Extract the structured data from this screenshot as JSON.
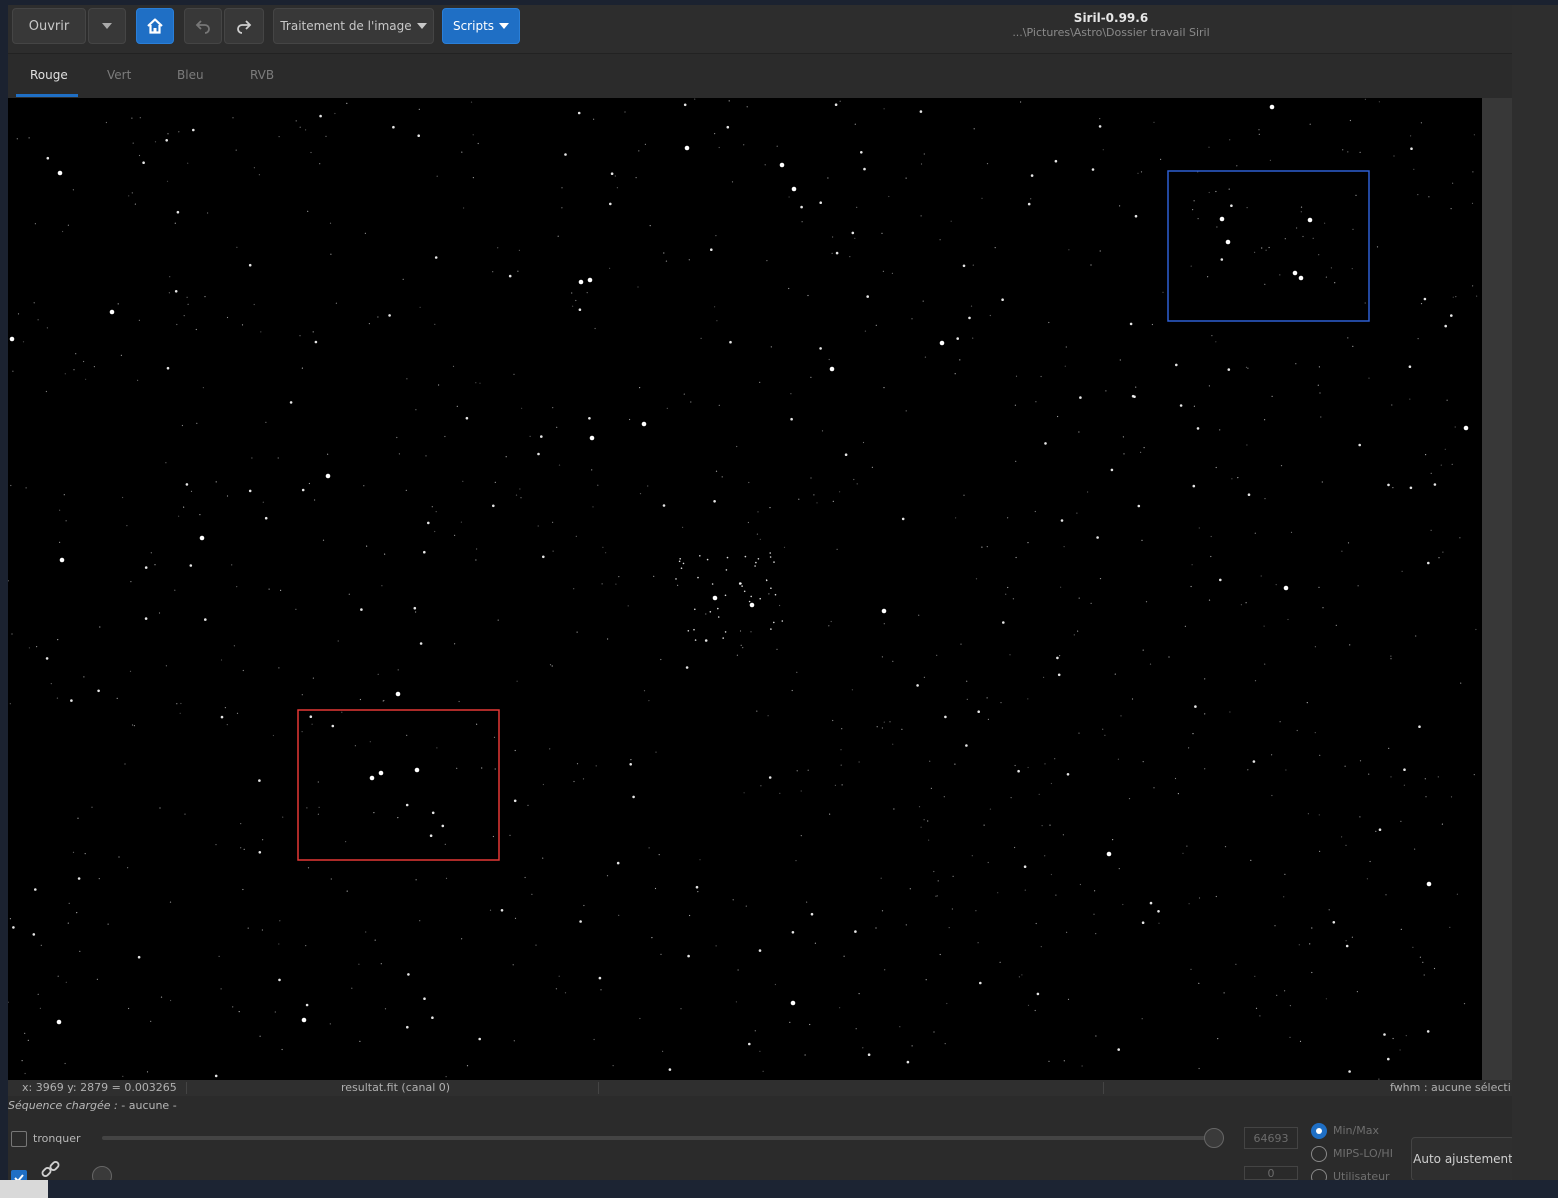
{
  "toolbar": {
    "open_label": "Ouvrir",
    "image_processing_label": "Traitement de l'image",
    "scripts_label": "Scripts"
  },
  "title": {
    "app": "Siril-0.99.6",
    "path": "...\\Pictures\\Astro\\Dossier travail Siril"
  },
  "tabs": [
    "Rouge",
    "Vert",
    "Bleu",
    "RVB"
  ],
  "colors": {
    "accent": "#1f6fc5",
    "selection_blue": "#2d5fd3",
    "selection_red": "#e53935"
  },
  "status": {
    "coords": "x: 3969 y: 2879 = 0.003265",
    "file": "resultat.fit (canal 0)",
    "fwhm": "fwhm : aucune sélecti"
  },
  "sequence": {
    "label": "Séquence chargée :",
    "value": " - aucune -"
  },
  "controls": {
    "clip_label": "tronquer",
    "high_value": "64693",
    "low_value": "0",
    "modes": [
      "Min/Max",
      "MIPS-LO/HI",
      "Utilisateur"
    ],
    "auto_label": "Auto ajustement"
  }
}
